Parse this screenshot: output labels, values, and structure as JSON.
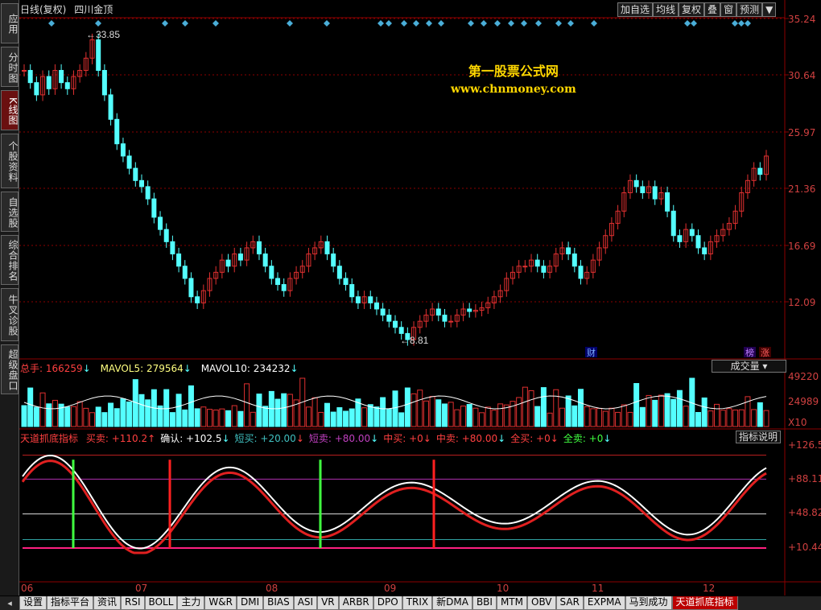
{
  "sidebar": {
    "items": [
      "应用",
      "分时图",
      "K线图",
      "个股资料",
      "自选股",
      "综合排名",
      "牛叉诊股",
      "超级盘口"
    ]
  },
  "header": {
    "period": "日线(复权)",
    "stock_name": "四川金顶"
  },
  "toolbar": {
    "buttons": [
      "加自选",
      "均线",
      "复权",
      "叠",
      "窗",
      "预测"
    ]
  },
  "watermark": {
    "line1": "第一股票公式网",
    "line2": "www.chnmoney.com"
  },
  "price_axis": [
    "35.24",
    "30.64",
    "25.97",
    "21.36",
    "16.69",
    "12.09"
  ],
  "price_notes": {
    "high": "33.85",
    "low": "8.81",
    "fin_marker": "财",
    "rank_marker": "榜",
    "limit_marker": "涨"
  },
  "volume": {
    "total_label": "总手: 166259",
    "mavol5": "MAVOL5: 279564",
    "mavol10": "MAVOL10: 234232",
    "selector": "成交量",
    "axis": [
      "49220",
      "24989",
      "X10"
    ]
  },
  "indicator": {
    "name": "天道抓底指标",
    "items": [
      {
        "text": "买卖: +110.2",
        "color": "#ff4040"
      },
      {
        "text": "确认: +102.5",
        "color": "#ffffff"
      },
      {
        "text": "短买: +20.00",
        "color": "#40c0c0"
      },
      {
        "text": "短卖: +80.00",
        "color": "#c040c0"
      },
      {
        "text": "中买: +0",
        "color": "#ff4040"
      },
      {
        "text": "中卖: +80.00",
        "color": "#ff4040"
      },
      {
        "text": "全买: +0",
        "color": "#ff4040"
      },
      {
        "text": "全卖: +0",
        "color": "#40ff40"
      }
    ],
    "explain_button": "指标说明",
    "axis": [
      "+126.5",
      "+88.11",
      "+48.82",
      "+10.44"
    ]
  },
  "x_axis": [
    "06",
    "07",
    "08",
    "09",
    "10",
    "11",
    "12"
  ],
  "bottom_tabs": [
    "设置",
    "指标平台",
    "资讯",
    "RSI",
    "BOLL",
    "主力",
    "W&R",
    "DMI",
    "BIAS",
    "ASI",
    "VR",
    "ARBR",
    "DPO",
    "TRIX",
    "新DMA",
    "BBI",
    "MTM",
    "OBV",
    "SAR",
    "EXPMA",
    "马到成功",
    "天道抓底指标"
  ],
  "colors": {
    "up": "#e03030",
    "down": "#54ffff",
    "grid": "#8b0000"
  }
}
